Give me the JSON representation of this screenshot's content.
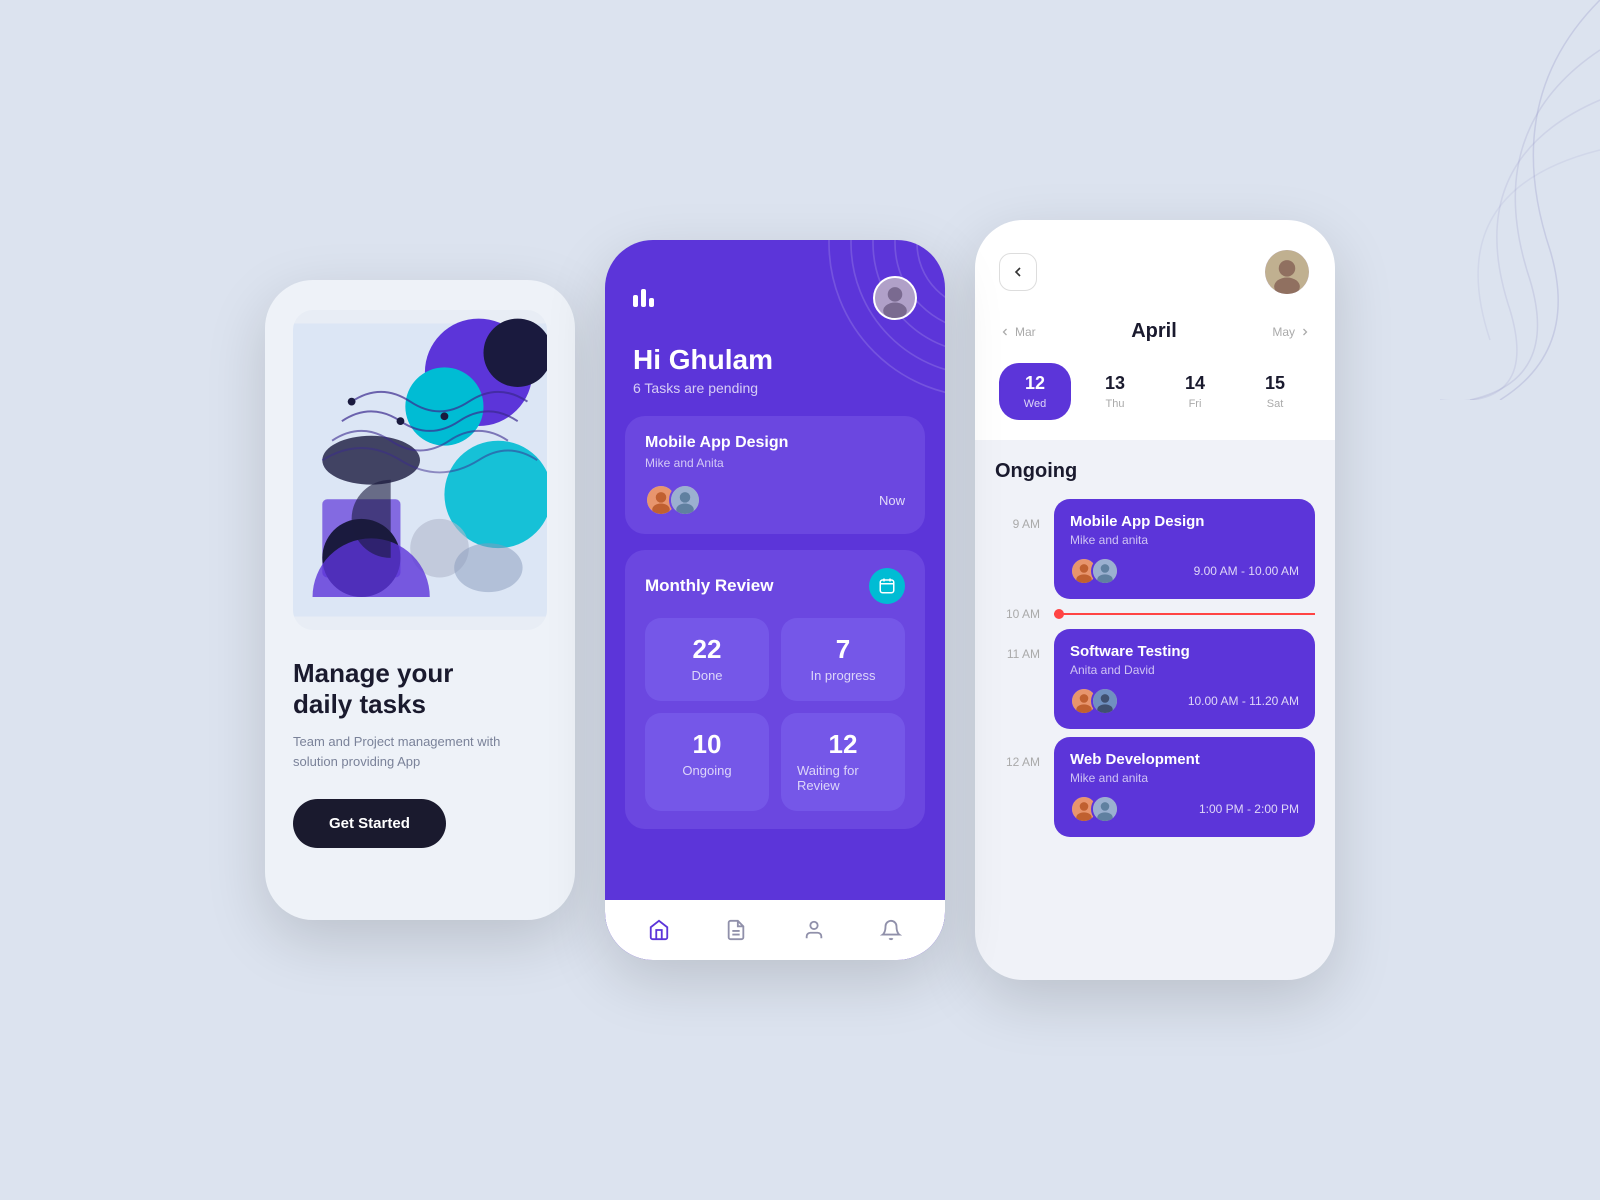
{
  "background": {
    "color": "#dce3ef"
  },
  "phone1": {
    "title_line1": "Manage your",
    "title_line2": "daily tasks",
    "subtitle": "Team and Project management with solution providing App",
    "cta_label": "Get Started"
  },
  "phone2": {
    "greeting": "Hi Ghulam",
    "tasks_pending": "6 Tasks are pending",
    "task_card": {
      "title": "Mobile App Design",
      "assignees": "Mike and Anita",
      "time": "Now"
    },
    "review_section": {
      "title": "Monthly Review",
      "stats": [
        {
          "number": "22",
          "label": "Done"
        },
        {
          "number": "7",
          "label": "In progress"
        },
        {
          "number": "10",
          "label": "Ongoing"
        },
        {
          "number": "12",
          "label": "Waiting for Review"
        }
      ]
    },
    "nav_items": [
      "home",
      "document",
      "person",
      "bell"
    ]
  },
  "phone3": {
    "month": "April",
    "prev_month": "Mar",
    "next_month": "May",
    "days": [
      {
        "num": "12",
        "name": "Wed",
        "active": true
      },
      {
        "num": "13",
        "name": "Thu",
        "active": false
      },
      {
        "num": "14",
        "name": "Fri",
        "active": false
      },
      {
        "num": "15",
        "name": "Sat",
        "active": false
      }
    ],
    "section_title": "Ongoing",
    "meetings": [
      {
        "time_before": "9 AM",
        "title": "Mobile App Design",
        "sub": "Mike and anita",
        "time": "9.00 AM - 10.00 AM",
        "has_line": false
      },
      {
        "time_before": "10 AM",
        "title": "Software Testing",
        "sub": "Anita and David",
        "time": "10.00 AM - 11.20 AM",
        "has_line": true
      },
      {
        "time_before": "12 AM",
        "title": "Web Development",
        "sub": "Mike and anita",
        "time": "1:00 PM - 2:00 PM",
        "has_line": false
      }
    ],
    "current_time_label": "10 AM",
    "current_time_before_second": "11 AM",
    "before_third": "12 AM"
  }
}
